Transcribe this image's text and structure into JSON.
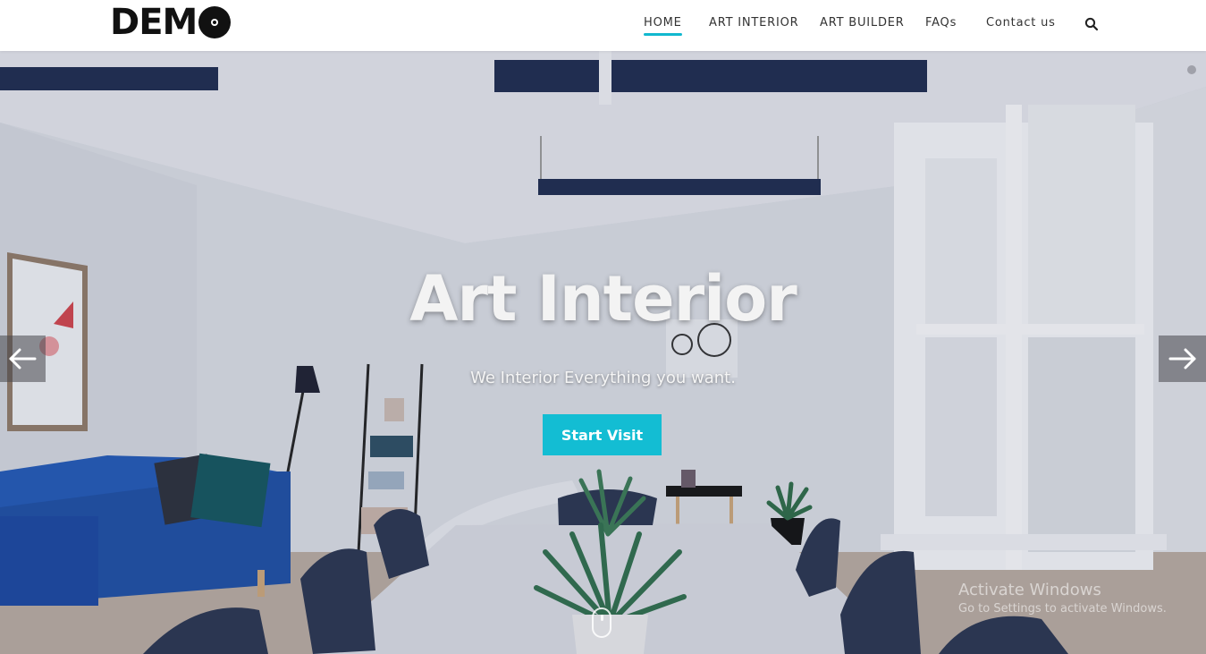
{
  "logo": {
    "text_prefix": "DEM"
  },
  "nav": {
    "items": [
      {
        "label": "HOME",
        "active": true
      },
      {
        "label": "ART INTERIOR",
        "active": false
      },
      {
        "label": "ART BUILDER",
        "active": false
      },
      {
        "label": "FAQs",
        "active": false
      },
      {
        "label": "Contact us",
        "active": false
      }
    ],
    "search_icon": "search-icon"
  },
  "hero": {
    "title": "Art Interior",
    "subtitle": "We Interior Everything you want.",
    "cta_label": "Start Visit",
    "prev_icon": "arrow-left-icon",
    "next_icon": "arrow-right-icon",
    "scroll_icon": "mouse-scroll-icon"
  },
  "watermark": {
    "title": "Activate Windows",
    "subtitle": "Go to Settings to activate Windows."
  },
  "colors": {
    "accent": "#13bdd3",
    "nav_text": "#333333",
    "logo": "#111111"
  }
}
